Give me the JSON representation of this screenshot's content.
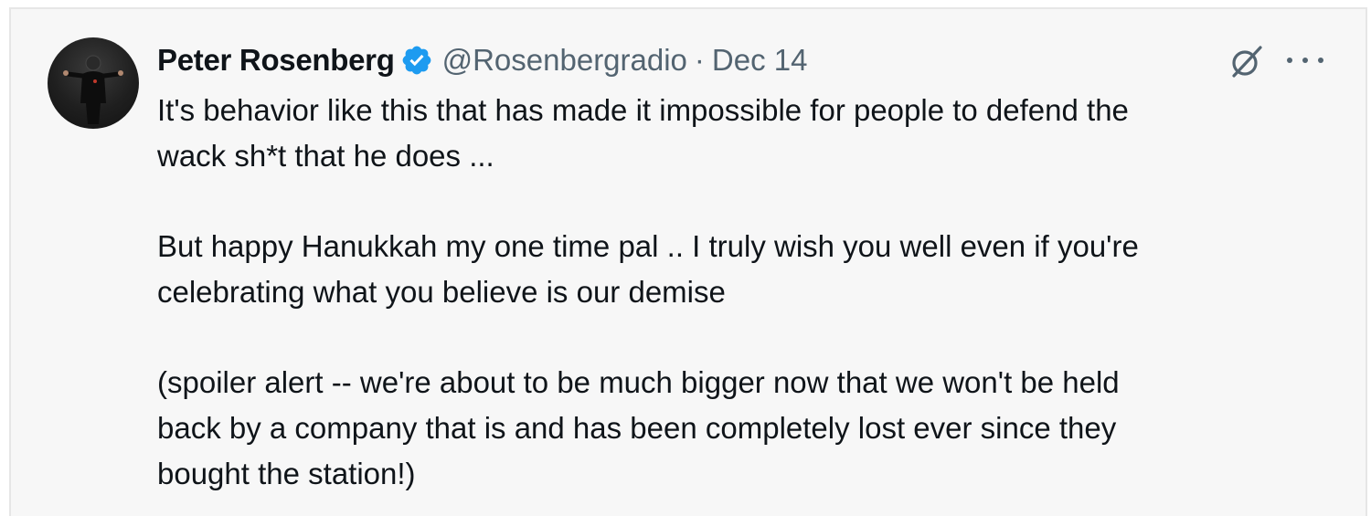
{
  "tweet": {
    "author_name": "Peter Rosenberg",
    "handle": "@Rosenbergradio",
    "separator": "·",
    "date": "Dec 14",
    "paragraphs": [
      "It's behavior like this that has made it impossible for people to defend the\nwack sh*t that he does ...",
      "But happy Hanukkah my one time pal .. I truly wish you well even if you're\ncelebrating what you believe is our demise",
      " (spoiler alert -- we're about to be much bigger now that we won't be held\nback by a company that is and has been completely lost ever since they\nbought the station!)"
    ]
  },
  "icons": {
    "verified": "verified-badge-icon",
    "grok": "grok-icon",
    "more": "more-options-icon"
  },
  "colors": {
    "background": "#f7f7f7",
    "text_primary": "#0f1419",
    "text_secondary": "#536471",
    "verified_blue": "#1d9bf0"
  }
}
